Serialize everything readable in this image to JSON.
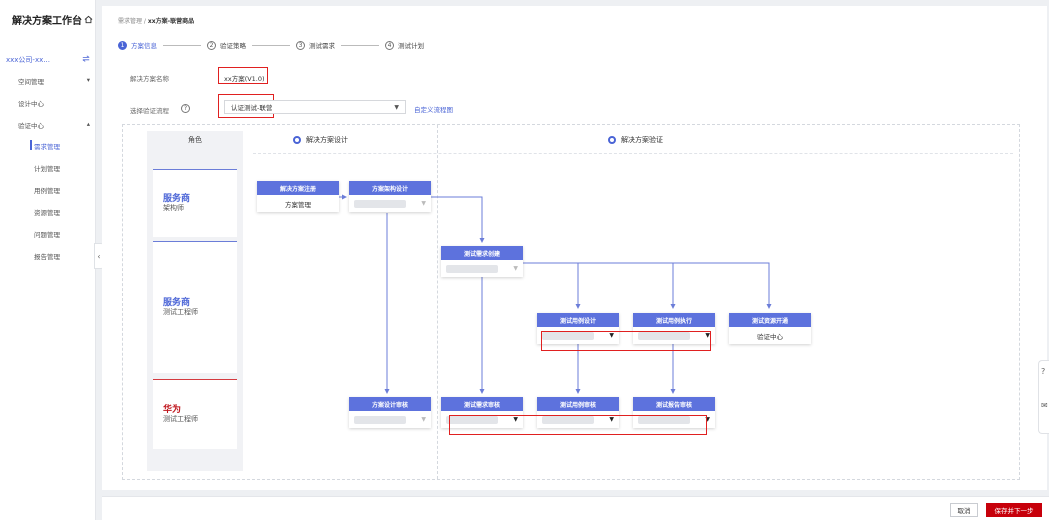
{
  "sidebar": {
    "title": "解决方案工作台",
    "company": "xxx公司-xx...",
    "items": [
      {
        "label": "空间管理",
        "caret": "▾"
      },
      {
        "label": "设计中心",
        "caret": ""
      },
      {
        "label": "验证中心",
        "caret": "▴"
      }
    ],
    "subitems": [
      "需求管理",
      "计划管理",
      "用例管理",
      "资源管理",
      "问题管理",
      "报告管理"
    ]
  },
  "breadcrumb": {
    "parent": "需求管理 / ",
    "current": "xx方案-联营商品"
  },
  "steps": [
    {
      "num": "1",
      "label": "方案信息"
    },
    {
      "num": "2",
      "label": "验证策略"
    },
    {
      "num": "3",
      "label": "测试需求"
    },
    {
      "num": "4",
      "label": "测试计划"
    }
  ],
  "form": {
    "name_label": "解决方案名称",
    "name_value": "xx方案(V1.0)",
    "flow_label": "选择验证流程",
    "flow_value": "认证测试-联营",
    "custom_link": "自定义流程图"
  },
  "flow": {
    "role_header": "角色",
    "roles": [
      {
        "name": "服务商",
        "sub": "架构师"
      },
      {
        "name": "服务商",
        "sub": "测试工程师"
      },
      {
        "name": "华为",
        "sub": "测试工程师"
      }
    ],
    "columns": [
      "解决方案设计",
      "解决方案验证"
    ],
    "nodes": {
      "register": {
        "title": "解决方案注册",
        "body": "方案管理"
      },
      "arch": {
        "title": "方案架构设计"
      },
      "req_create": {
        "title": "测试需求创建"
      },
      "case_design": {
        "title": "测试用例设计"
      },
      "case_exec": {
        "title": "测试用例执行"
      },
      "resource": {
        "title": "测试资源开通",
        "body": "验证中心"
      },
      "design_review": {
        "title": "方案设计审核"
      },
      "req_review": {
        "title": "测试需求审核"
      },
      "case_review": {
        "title": "测试用例审核"
      },
      "report_review": {
        "title": "测试报告审核"
      }
    }
  },
  "footer": {
    "cancel": "取消",
    "next": "保存并下一步"
  },
  "colors": {
    "accent": "#4a64d6",
    "primary_red": "#c7000b",
    "highlight": "#e02020"
  }
}
